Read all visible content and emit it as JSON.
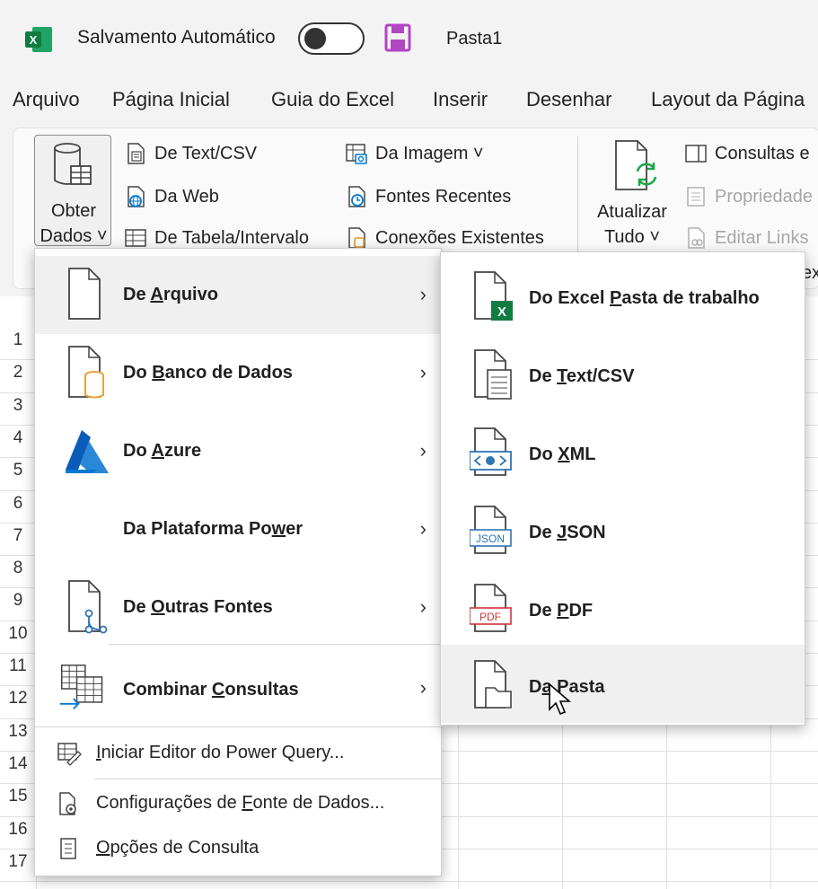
{
  "titlebar": {
    "autosave_label": "Salvamento Automático",
    "workbook_name": "Pasta1"
  },
  "tabs": [
    "Arquivo",
    "Página Inicial",
    "Guia do Excel",
    "Inserir",
    "Desenhar",
    "Layout da Página"
  ],
  "ribbon": {
    "obter_dados": {
      "line1": "Obter",
      "line2": "Dados ˅"
    },
    "get_items": [
      {
        "label": "De Text/CSV",
        "icon": "text-file-icon"
      },
      {
        "label": "Da Web",
        "icon": "web-icon"
      },
      {
        "label": "De Tabela/Intervalo",
        "icon": "table-icon"
      },
      {
        "label": "Da Imagem ˅",
        "icon": "image-icon"
      },
      {
        "label": "Fontes Recentes",
        "icon": "recent-sources-icon"
      },
      {
        "label": "Conexões Existentes",
        "icon": "existing-connections-icon"
      }
    ],
    "atualizar": {
      "line1": "Atualizar",
      "line2": "Tudo ˅"
    },
    "query_items": [
      {
        "label": "Consultas e",
        "disabled": false
      },
      {
        "label": "Propriedade",
        "disabled": true
      },
      {
        "label": "Editar Links",
        "disabled": true
      }
    ],
    "partial_text": "ex"
  },
  "rows": [
    "1",
    "2",
    "3",
    "4",
    "5",
    "6",
    "7",
    "8",
    "9",
    "10",
    "11",
    "12",
    "13",
    "14",
    "15",
    "16",
    "17"
  ],
  "menu1": {
    "items": [
      {
        "label": "De Arquivo",
        "underline": "A",
        "pre": "De ",
        "post": "rquivo",
        "icon": "file-icon",
        "hover": true
      },
      {
        "label": "Do Banco de Dados",
        "pre": "Do ",
        "underline": "B",
        "post": "anco de Dados",
        "icon": "database-file-icon"
      },
      {
        "label": "Do Azure",
        "pre": "Do ",
        "underline": "A",
        "post": "zure",
        "icon": "azure-icon"
      },
      {
        "label": "Da Plataforma Power",
        "pre": "Da Plataforma Po",
        "underline": "w",
        "post": "er",
        "icon": ""
      },
      {
        "label": "De Outras Fontes",
        "pre": "De ",
        "underline": "O",
        "post": "utras Fontes",
        "icon": "other-sources-icon"
      },
      {
        "label": "Combinar Consultas",
        "pre": "Combinar ",
        "underline": "C",
        "post": "onsultas",
        "icon": "combine-queries-icon"
      }
    ],
    "small_items": [
      {
        "pre": "",
        "underline": "I",
        "post": "niciar Editor do Power Query...",
        "icon": "power-query-editor-icon"
      },
      {
        "pre": "Configurações de ",
        "underline": "F",
        "post": "onte de Dados...",
        "icon": "data-source-settings-icon"
      },
      {
        "pre": "",
        "underline": "O",
        "post": "pções de Consulta",
        "icon": "query-options-icon"
      }
    ]
  },
  "menu2": {
    "items": [
      {
        "pre": "Do Excel ",
        "underline": "P",
        "post": "asta de trabalho",
        "icon": "excel-workbook-icon"
      },
      {
        "pre": "De ",
        "underline": "T",
        "post": "ext/CSV",
        "icon": "text-csv-icon"
      },
      {
        "pre": "Do ",
        "underline": "X",
        "post": "ML",
        "icon": "xml-icon",
        "badge": "<⊕>"
      },
      {
        "pre": "De ",
        "underline": "J",
        "post": "SON",
        "icon": "json-icon",
        "badge": "JSON"
      },
      {
        "pre": "De ",
        "underline": "P",
        "post": "DF",
        "icon": "pdf-icon",
        "badge": "PDF"
      },
      {
        "pre": "D",
        "underline": "a",
        "post": " Pasta",
        "icon": "folder-icon",
        "hover": true
      }
    ]
  },
  "colors": {
    "excel_green": "#107c41",
    "save_purple": "#b146c2",
    "azure_blue": "#0078d4",
    "db_orange": "#e8a33d",
    "refresh_green": "#1aa84a",
    "pdf_red": "#d13438",
    "link_blue": "#2e75b6"
  }
}
